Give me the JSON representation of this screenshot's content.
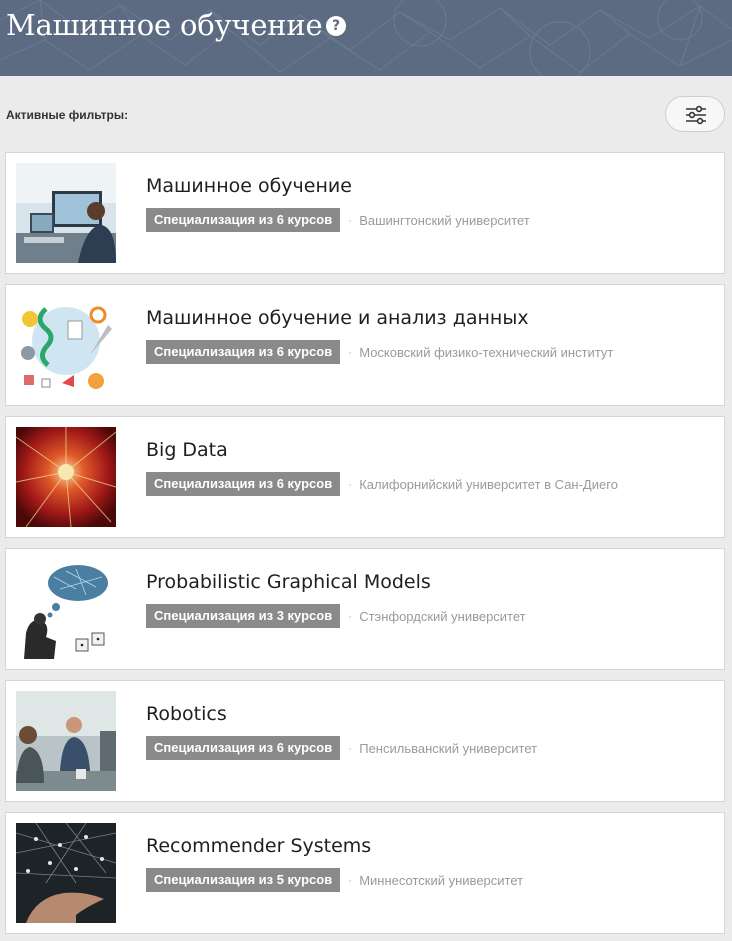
{
  "header": {
    "title": "Машинное обучение",
    "help_icon": "question-circle-icon",
    "background_color": "#5c6a82"
  },
  "filters": {
    "label": "Активные фильтры:",
    "button_icon": "sliders-icon"
  },
  "courses": [
    {
      "title": "Машинное обучение",
      "badge": "Специализация из 6 курсов",
      "separator": "·",
      "organization": "Вашингтонский университет",
      "thumbnail": "person-at-computer-image"
    },
    {
      "title": "Машинное обучение и анализ данных",
      "badge": "Специализация из 6 курсов",
      "separator": "·",
      "organization": "Московский физико-технический институт",
      "thumbnail": "illustrated-data-icons-image"
    },
    {
      "title": "Big Data",
      "badge": "Специализация из 6 курсов",
      "separator": "·",
      "organization": "Калифорнийский университет в Сан-Диего",
      "thumbnail": "red-fractal-image"
    },
    {
      "title": "Probabilistic Graphical Models",
      "badge": "Специализация из 3 курсов",
      "separator": "·",
      "organization": "Стэнфордский университет",
      "thumbnail": "thinker-with-dice-image"
    },
    {
      "title": "Robotics",
      "badge": "Специализация из 6 курсов",
      "separator": "·",
      "organization": "Пенсильванский университет",
      "thumbnail": "people-meeting-image"
    },
    {
      "title": "Recommender Systems",
      "badge": "Специализация из 5 курсов",
      "separator": "·",
      "organization": "Миннесотский университет",
      "thumbnail": "hand-network-image"
    }
  ],
  "colors": {
    "page_background": "#ebebeb",
    "badge_background": "#8a8a8a",
    "organization_text": "#9a9a9a"
  }
}
